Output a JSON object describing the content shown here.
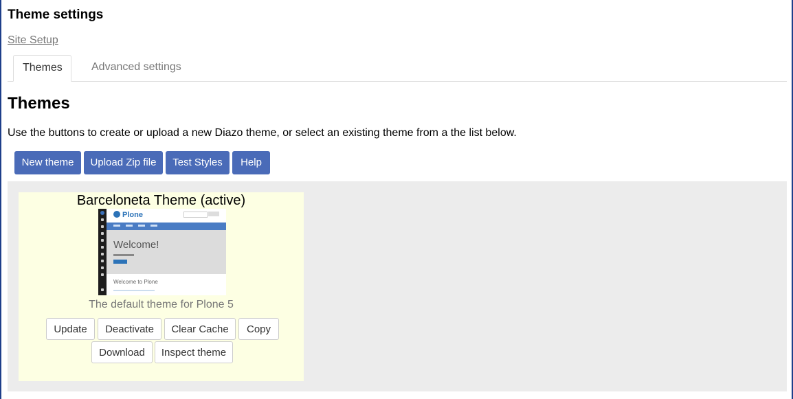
{
  "header": {
    "title": "Theme settings"
  },
  "breadcrumb": {
    "site_setup": "Site Setup"
  },
  "tabs": [
    {
      "label": "Themes",
      "active": true
    },
    {
      "label": "Advanced settings",
      "active": false
    }
  ],
  "main": {
    "title": "Themes",
    "intro": "Use the buttons to create or upload a new Diazo theme, or select an existing theme from a the list below.",
    "buttons": {
      "new_theme": "New theme",
      "upload_zip": "Upload Zip file",
      "test_styles": "Test Styles",
      "help": "Help"
    }
  },
  "theme_card": {
    "title": "Barceloneta Theme (active)",
    "description": "The default theme for Plone 5",
    "preview": {
      "logo": "Plone",
      "welcome": "Welcome!",
      "footer": "Welcome to Plone"
    },
    "actions": {
      "update": "Update",
      "deactivate": "Deactivate",
      "clear_cache": "Clear Cache",
      "copy": "Copy",
      "download": "Download",
      "inspect": "Inspect theme"
    }
  },
  "colors": {
    "primary_button": "#4a6bb8",
    "theme_card_bg": "#fdffe3",
    "themes_area_bg": "#ececec"
  }
}
